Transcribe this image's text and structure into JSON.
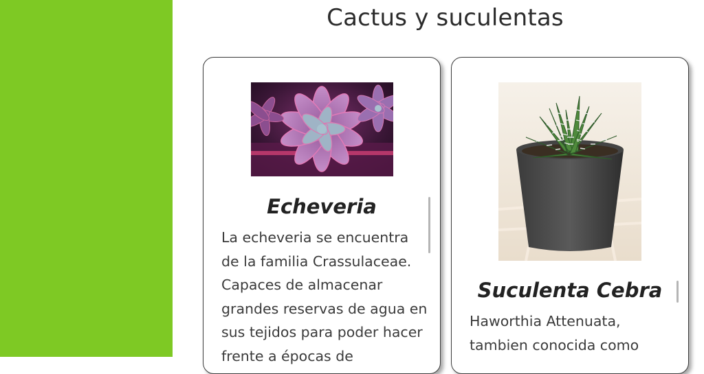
{
  "section": {
    "title": "Cactus y suculentas"
  },
  "cards": [
    {
      "title": "Echeveria",
      "text": "La echeveria se encuentra de la familia Crassulaceae. Capaces de almacenar grandes reservas de agua en sus tejidos para poder hacer frente a épocas de"
    },
    {
      "title": "Suculenta Cebra",
      "text": "Haworthia Attenuata, tambien conocida como"
    }
  ],
  "colors": {
    "sidebar": "#7ec924",
    "card_border": "#3a3a3a",
    "title_text": "#2b2b2b"
  }
}
